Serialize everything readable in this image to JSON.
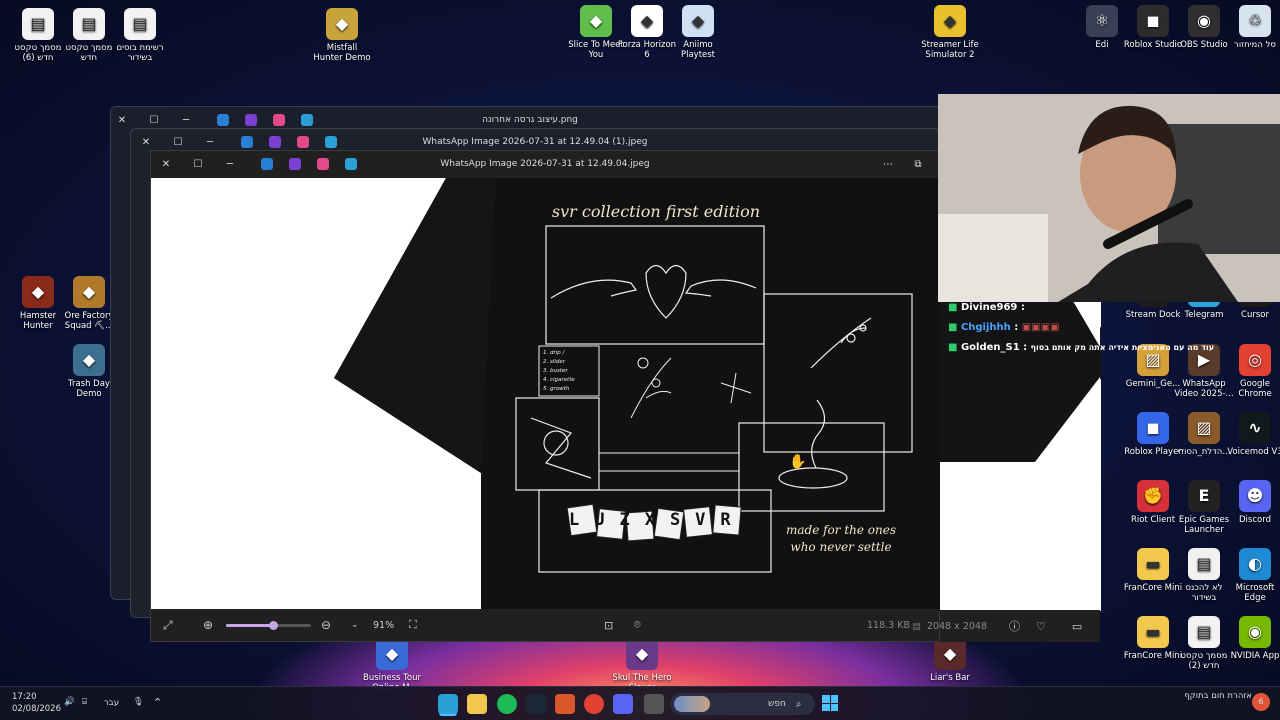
{
  "desktop_icons": [
    {
      "id": "txt6",
      "label": "מסמך טקסט חדש (6)",
      "icon": "document-icon",
      "color": "#f2f2f2"
    },
    {
      "id": "txtnew",
      "label": "מסמך טקסט חדש",
      "icon": "document-icon",
      "color": "#f2f2f2"
    },
    {
      "id": "wordslist",
      "label": "רשימת בוסים בשידור",
      "icon": "document-icon",
      "color": "#f2f2f2"
    },
    {
      "id": "mistfall",
      "label": "Mistfall Hunter Demo",
      "icon": "game-icon",
      "color": "#c8a33a"
    },
    {
      "id": "slice",
      "label": "Slice To Meet You",
      "icon": "game-icon",
      "color": "#5fbf4a"
    },
    {
      "id": "forza",
      "label": "Forza Horizon 6",
      "icon": "game-icon",
      "color": "#ffffff"
    },
    {
      "id": "aniimo",
      "label": "Aniimo Playtest",
      "icon": "game-icon",
      "color": "#cfe0f5"
    },
    {
      "id": "streamer",
      "label": "Streamer Life Simulator 2",
      "icon": "game-icon",
      "color": "#e8c12c"
    },
    {
      "id": "edi",
      "label": "Edi",
      "icon": "atom-icon",
      "color": "#3a3f55"
    },
    {
      "id": "robloxstudio",
      "label": "Roblox Studio",
      "icon": "roblox-icon",
      "color": "#2c2c2c"
    },
    {
      "id": "obs",
      "label": "OBS Studio",
      "icon": "obs-icon",
      "color": "#302e31"
    },
    {
      "id": "recycle",
      "label": "סל המיחזור",
      "icon": "recycle-bin-icon",
      "color": "#d7e3ee"
    },
    {
      "id": "hamster",
      "label": "Hamster Hunter",
      "icon": "game-icon",
      "color": "#8a2a1a"
    },
    {
      "id": "orefactory",
      "label": "Ore Factory Squad ⛏...",
      "icon": "game-icon",
      "color": "#b07a2a"
    },
    {
      "id": "trashday",
      "label": "Trash Day Demo",
      "icon": "game-icon",
      "color": "#3b6e8f"
    },
    {
      "id": "streamdock",
      "label": "Stream Dock",
      "icon": "app-icon",
      "color": "#1c1c1c"
    },
    {
      "id": "telegram",
      "label": "Telegram",
      "icon": "telegram-icon",
      "color": "#2aa3df"
    },
    {
      "id": "cursor",
      "label": "Cursor",
      "icon": "cursor-icon",
      "color": "#1c1c1c"
    },
    {
      "id": "gemini",
      "label": "Gemini_Ge...",
      "icon": "image-icon",
      "color": "#d3a03a"
    },
    {
      "id": "whatsappvid",
      "label": "WhatsApp Video 2025-...",
      "icon": "video-icon",
      "color": "#5a3a2a"
    },
    {
      "id": "chrome",
      "label": "Google Chrome",
      "icon": "chrome-icon",
      "color": "#e34133"
    },
    {
      "id": "robloxplayer",
      "label": "Roblox Player",
      "icon": "roblox-icon",
      "color": "#3367e8"
    },
    {
      "id": "hadlakat",
      "label": "הדלת_הסודי...",
      "icon": "image-icon",
      "color": "#8a5a2a"
    },
    {
      "id": "voicemod",
      "label": "Voicemod V3",
      "icon": "voicemod-icon",
      "color": "#0f1a1a"
    },
    {
      "id": "riot",
      "label": "Riot Client",
      "icon": "riot-icon",
      "color": "#d6303a"
    },
    {
      "id": "epic",
      "label": "Epic Games Launcher",
      "icon": "epic-icon",
      "color": "#222222"
    },
    {
      "id": "discord",
      "label": "Discord",
      "icon": "discord-icon",
      "color": "#5865f2"
    },
    {
      "id": "francore1",
      "label": "FranCore Mini",
      "icon": "folder-icon",
      "color": "#f2c94c"
    },
    {
      "id": "lohikanes",
      "label": "לא להכנס בשידור",
      "icon": "document-icon",
      "color": "#f2f2f2"
    },
    {
      "id": "edge",
      "label": "Microsoft Edge",
      "icon": "edge-icon",
      "color": "#1f8ad4"
    },
    {
      "id": "francore2",
      "label": "FranCore Mini",
      "icon": "folder-icon",
      "color": "#f2c94c"
    },
    {
      "id": "txt2",
      "label": "מסמך טקסט חדש (2)",
      "icon": "document-icon",
      "color": "#f2f2f2"
    },
    {
      "id": "nvidia",
      "label": "NVIDIA App",
      "icon": "nvidia-icon",
      "color": "#76b900"
    },
    {
      "id": "business",
      "label": "Business Tour - Online M...",
      "icon": "game-icon",
      "color": "#3a6ad8"
    },
    {
      "id": "skul",
      "label": "Skul The Hero Slayer",
      "icon": "game-icon",
      "color": "#6a3a8a"
    },
    {
      "id": "liars",
      "label": "Liar's Bar",
      "icon": "game-icon",
      "color": "#5a2a2a"
    }
  ],
  "back_window_1": {
    "title": "עיצוב גרסה אחרונה.png"
  },
  "back_window_2": {
    "title": "WhatsApp Image 2026-07-31 at 12.49.04 (1).jpeg"
  },
  "viewer": {
    "title": "WhatsApp Image 2026-07-31 at 12.49.04.jpeg",
    "zoom": "91%",
    "file_size": "118.3 KB",
    "dimensions": "2048 x 2048",
    "zoom_level_fraction": 0.55
  },
  "shirt": {
    "headline": "svr collection first edition",
    "dice_text": "LUZXSVR",
    "tagline_1": "made for the ones",
    "tagline_2": "who never settle",
    "list": [
      "1. drip /",
      "2. slider",
      "3. buster",
      "4. cigarette",
      "5. growth"
    ]
  },
  "chat": [
    {
      "user": "Divine969",
      "text": ""
    },
    {
      "user": "Chgijhhh",
      "text": ""
    },
    {
      "user": "Golden_S1",
      "text": "עוד מה עם האנימציות אידיה אתה מק אותם בסוף"
    }
  ],
  "taskbar": {
    "time": "17:20",
    "date": "02/08/2026",
    "lang": "עבר",
    "search_placeholder": "חפש",
    "notification": "אזהרת חום בתוקף",
    "notification_count": "6"
  },
  "colors": {
    "accent": "#4cc2ff",
    "chat_green": "#2ecc71",
    "chat_blue": "#4aa3ff"
  }
}
